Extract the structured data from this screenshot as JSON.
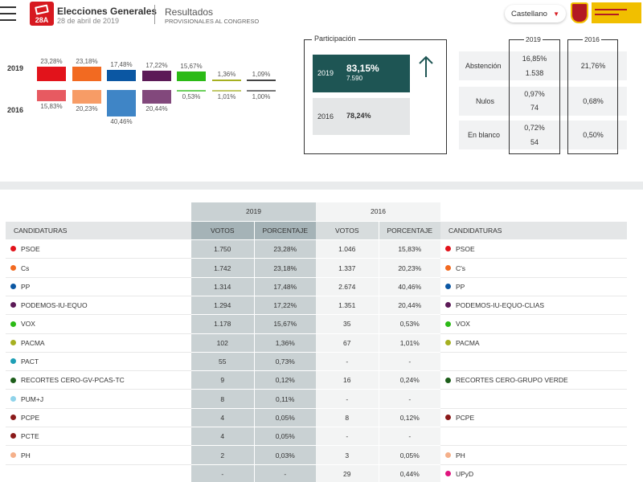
{
  "header": {
    "logo_text": "28A",
    "app_title": "Elecciones Generales",
    "date": "28 de abril de 2019",
    "results_title": "Resultados",
    "results_subtitle": "PROVISIONALES AL CONGRESO",
    "language": "Castellano",
    "caret": "▼"
  },
  "top_bars": {
    "year_top": "2019",
    "year_bottom": "2016",
    "parties": [
      {
        "color19": "#e2131b",
        "color16": "#e75a61",
        "pct19": "23,28%",
        "pct16": "15,83%",
        "v19": 23.28,
        "v16": 15.83
      },
      {
        "color19": "#f26a21",
        "color16": "#f79c66",
        "pct19": "23,18%",
        "pct16": "20,23%",
        "v19": 23.18,
        "v16": 20.23
      },
      {
        "color19": "#0b57a3",
        "color16": "#3f85c6",
        "pct19": "17,48%",
        "pct16": "40,46%",
        "v19": 17.48,
        "v16": 40.46
      },
      {
        "color19": "#5c1a57",
        "color16": "#82487c",
        "pct19": "17,22%",
        "pct16": "20,44%",
        "v19": 17.22,
        "v16": 20.44
      },
      {
        "color19": "#2bba16",
        "color16": "#6ccf5c",
        "pct19": "15,67%",
        "pct16": "0,53%",
        "v19": 15.67,
        "v16": 0.53
      },
      {
        "color19": "#a6b021",
        "color16": "#c2c96a",
        "pct19": "1,36%",
        "pct16": "1,01%",
        "v19": 1.36,
        "v16": 1.01
      },
      {
        "color19": "#444444",
        "color16": "#777777",
        "pct19": "1,09%",
        "pct16": "1,00%",
        "v19": 1.09,
        "v16": 1.0
      }
    ]
  },
  "participation": {
    "title": "Participación",
    "y2019": "2019",
    "v2019": "83,15%",
    "n2019": "7.590",
    "y2016": "2016",
    "v2016": "78,24%"
  },
  "stats": {
    "col2019": "2019",
    "col2016": "2016",
    "rows": [
      {
        "label": "Abstención",
        "v19a": "16,85%",
        "v19b": "1.538",
        "v16": "21,76%"
      },
      {
        "label": "Nulos",
        "v19a": "0,97%",
        "v19b": "74",
        "v16": "0,68%"
      },
      {
        "label": "En blanco",
        "v19a": "0,72%",
        "v19b": "54",
        "v16": "0,50%"
      }
    ]
  },
  "table": {
    "year2019": "2019",
    "year2016": "2016",
    "col_candidaturas": "CANDIDATURAS",
    "col_votos": "VOTOS",
    "col_porcentaje": "PORCENTAJE",
    "rows": [
      {
        "name": "PSOE",
        "color": "#e2131b",
        "v19": "1.750",
        "p19": "23,28%",
        "v16": "1.046",
        "p16": "15,83%",
        "name2": "PSOE",
        "color2": "#e2131b"
      },
      {
        "name": "Cs",
        "color": "#f26a21",
        "v19": "1.742",
        "p19": "23,18%",
        "v16": "1.337",
        "p16": "20,23%",
        "name2": "C's",
        "color2": "#f26a21"
      },
      {
        "name": "PP",
        "color": "#0b57a3",
        "v19": "1.314",
        "p19": "17,48%",
        "v16": "2.674",
        "p16": "40,46%",
        "name2": "PP",
        "color2": "#0b57a3"
      },
      {
        "name": "PODEMOS-IU-EQUO",
        "color": "#5c1a57",
        "v19": "1.294",
        "p19": "17,22%",
        "v16": "1.351",
        "p16": "20,44%",
        "name2": "PODEMOS-IU-EQUO-CLIAS",
        "color2": "#5c1a57"
      },
      {
        "name": "VOX",
        "color": "#2bba16",
        "v19": "1.178",
        "p19": "15,67%",
        "v16": "35",
        "p16": "0,53%",
        "name2": "VOX",
        "color2": "#2bba16"
      },
      {
        "name": "PACMA",
        "color": "#a6b021",
        "v19": "102",
        "p19": "1,36%",
        "v16": "67",
        "p16": "1,01%",
        "name2": "PACMA",
        "color2": "#a6b021"
      },
      {
        "name": "PACT",
        "color": "#1e9fb5",
        "v19": "55",
        "p19": "0,73%",
        "v16": "-",
        "p16": "-",
        "name2": "",
        "color2": ""
      },
      {
        "name": "RECORTES CERO-GV-PCAS-TC",
        "color": "#1d5e1a",
        "v19": "9",
        "p19": "0,12%",
        "v16": "16",
        "p16": "0,24%",
        "name2": "RECORTES CERO-GRUPO VERDE",
        "color2": "#1d5e1a"
      },
      {
        "name": "PUM+J",
        "color": "#8fd3ea",
        "v19": "8",
        "p19": "0,11%",
        "v16": "-",
        "p16": "-",
        "name2": "",
        "color2": ""
      },
      {
        "name": "PCPE",
        "color": "#8b1a1a",
        "v19": "4",
        "p19": "0,05%",
        "v16": "8",
        "p16": "0,12%",
        "name2": "PCPE",
        "color2": "#8b1a1a"
      },
      {
        "name": "PCTE",
        "color": "#8b1a1a",
        "v19": "4",
        "p19": "0,05%",
        "v16": "-",
        "p16": "-",
        "name2": "",
        "color2": ""
      },
      {
        "name": "PH",
        "color": "#f5b08a",
        "v19": "2",
        "p19": "0,03%",
        "v16": "3",
        "p16": "0,05%",
        "name2": "PH",
        "color2": "#f5b08a"
      },
      {
        "name": "",
        "color": "",
        "v19": "-",
        "p19": "-",
        "v16": "29",
        "p16": "0,44%",
        "name2": "UPyD",
        "color2": "#e0157e"
      }
    ]
  }
}
